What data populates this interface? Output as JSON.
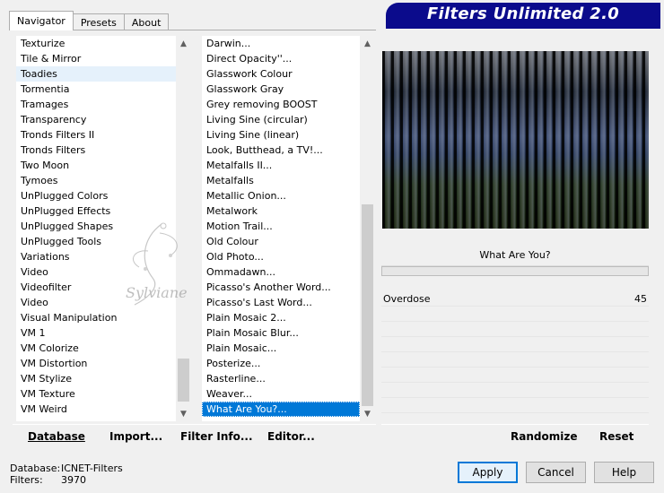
{
  "tabs": [
    "Navigator",
    "Presets",
    "About"
  ],
  "banner_title": "Filters Unlimited 2.0",
  "categories": [
    "Texturize",
    "Tile & Mirror",
    "Toadies",
    "Tormentia",
    "Tramages",
    "Transparency",
    "Tronds Filters II",
    "Tronds Filters",
    "Two Moon",
    "Tymoes",
    "UnPlugged Colors",
    "UnPlugged Effects",
    "UnPlugged Shapes",
    "UnPlugged Tools",
    "Variations",
    "Video",
    "Videofilter",
    "Video",
    "Visual Manipulation",
    "VM 1",
    "VM Colorize",
    "VM Distortion",
    "VM Stylize",
    "VM Texture",
    "VM Weird"
  ],
  "filters": [
    "Darwin...",
    "Direct Opacity''...",
    "Glasswork Colour",
    "Glasswork Gray",
    "Grey removing BOOST",
    "Living Sine (circular)",
    "Living Sine (linear)",
    "Look, Butthead, a TV!...",
    "Metalfalls II...",
    "Metalfalls",
    "Metallic Onion...",
    "Metalwork",
    "Motion Trail...",
    "Old Colour",
    "Old Photo...",
    "Ommadawn...",
    "Picasso's Another Word...",
    "Picasso's Last Word...",
    "Plain Mosaic 2...",
    "Plain Mosaic Blur...",
    "Plain Mosaic...",
    "Posterize...",
    "Rasterline...",
    "Weaver...",
    "What Are You?..."
  ],
  "selected_filter_name": "What Are You?",
  "params": {
    "name": "Overdose",
    "value": "45"
  },
  "left_buttons": {
    "database": "Database",
    "import": "Import...",
    "filter_info": "Filter Info...",
    "editor": "Editor..."
  },
  "right_buttons": {
    "randomize": "Randomize",
    "reset": "Reset"
  },
  "status": {
    "db_label": "Database:",
    "db_value": "ICNET-Filters",
    "filters_label": "Filters:",
    "filters_value": "3970"
  },
  "dialog_buttons": {
    "apply": "Apply",
    "cancel": "Cancel",
    "help": "Help"
  },
  "watermark_text": "Sylviane",
  "colors": {
    "banner": "#0b0b8c",
    "selection": "#0078d7"
  }
}
